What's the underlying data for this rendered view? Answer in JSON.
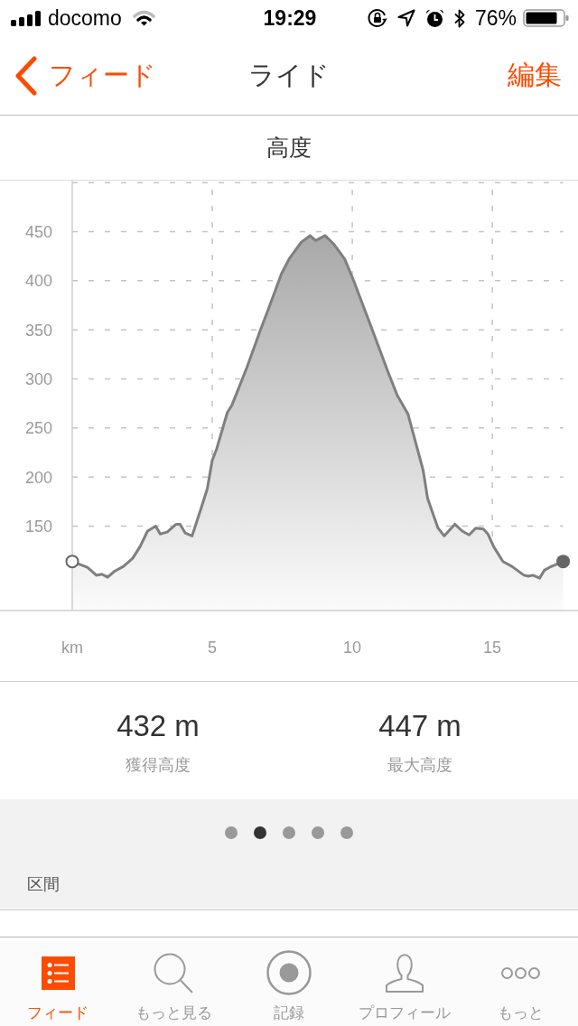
{
  "status_bar": {
    "carrier": "docomo",
    "time": "19:29",
    "battery": "76%"
  },
  "nav_bar": {
    "back_label": "フィード",
    "title": "ライド",
    "action": "編集"
  },
  "elevation_chart": {
    "chart_data": {
      "type": "area",
      "title": "高度",
      "xlabel": "km",
      "x": [
        0,
        0.54,
        0.86,
        1.06,
        1.26,
        1.51,
        1.83,
        2.15,
        2.42,
        2.69,
        2.98,
        3.14,
        3.39,
        3.71,
        3.85,
        4.03,
        4.28,
        4.6,
        4.82,
        5.0,
        5.16,
        5.54,
        5.7,
        6.24,
        6.72,
        6.99,
        7.47,
        7.74,
        8.17,
        8.49,
        8.69,
        9.03,
        9.35,
        9.73,
        10.05,
        10.65,
        11.29,
        11.61,
        11.99,
        12.53,
        12.69,
        13.06,
        13.28,
        13.66,
        13.93,
        14.17,
        14.41,
        14.68,
        14.84,
        15.05,
        15.38,
        15.7,
        16.13,
        16.29,
        16.45,
        16.69,
        16.86,
        17.04,
        17.53
      ],
      "values": [
        114,
        108,
        100,
        101,
        98,
        104,
        109,
        117,
        129,
        145,
        150,
        142,
        144,
        152,
        152,
        143,
        140,
        168,
        188,
        217,
        229,
        266,
        273,
        312,
        350,
        370,
        407,
        422,
        439,
        446,
        441,
        446,
        437,
        422,
        400,
        355,
        306,
        283,
        264,
        207,
        178,
        148,
        140,
        152,
        145,
        141,
        148,
        147,
        142,
        129,
        114,
        109,
        100,
        99,
        100,
        97,
        105,
        108,
        114
      ],
      "xlim": [
        -2.58,
        18.06
      ],
      "ylim": [
        64,
        502
      ],
      "xticks": [
        5,
        10,
        15
      ],
      "yticks": [
        150,
        200,
        250,
        300,
        350,
        400,
        450
      ],
      "grid": true
    }
  },
  "stats": [
    {
      "value": "432 m",
      "label": "獲得高度"
    },
    {
      "value": "447 m",
      "label": "最大高度"
    }
  ],
  "page_indicator": [
    {
      "selected": false
    },
    {
      "selected": true
    },
    {
      "selected": false
    },
    {
      "selected": false
    },
    {
      "selected": false
    }
  ],
  "segments": {
    "heading": "区間"
  },
  "tab_bar": [
    {
      "label": "フィード",
      "selected": true
    },
    {
      "label": "もっと見る",
      "selected": false
    },
    {
      "label": "記録",
      "selected": false
    },
    {
      "label": "プロフィール",
      "selected": false
    },
    {
      "label": "もっと",
      "selected": false
    }
  ]
}
